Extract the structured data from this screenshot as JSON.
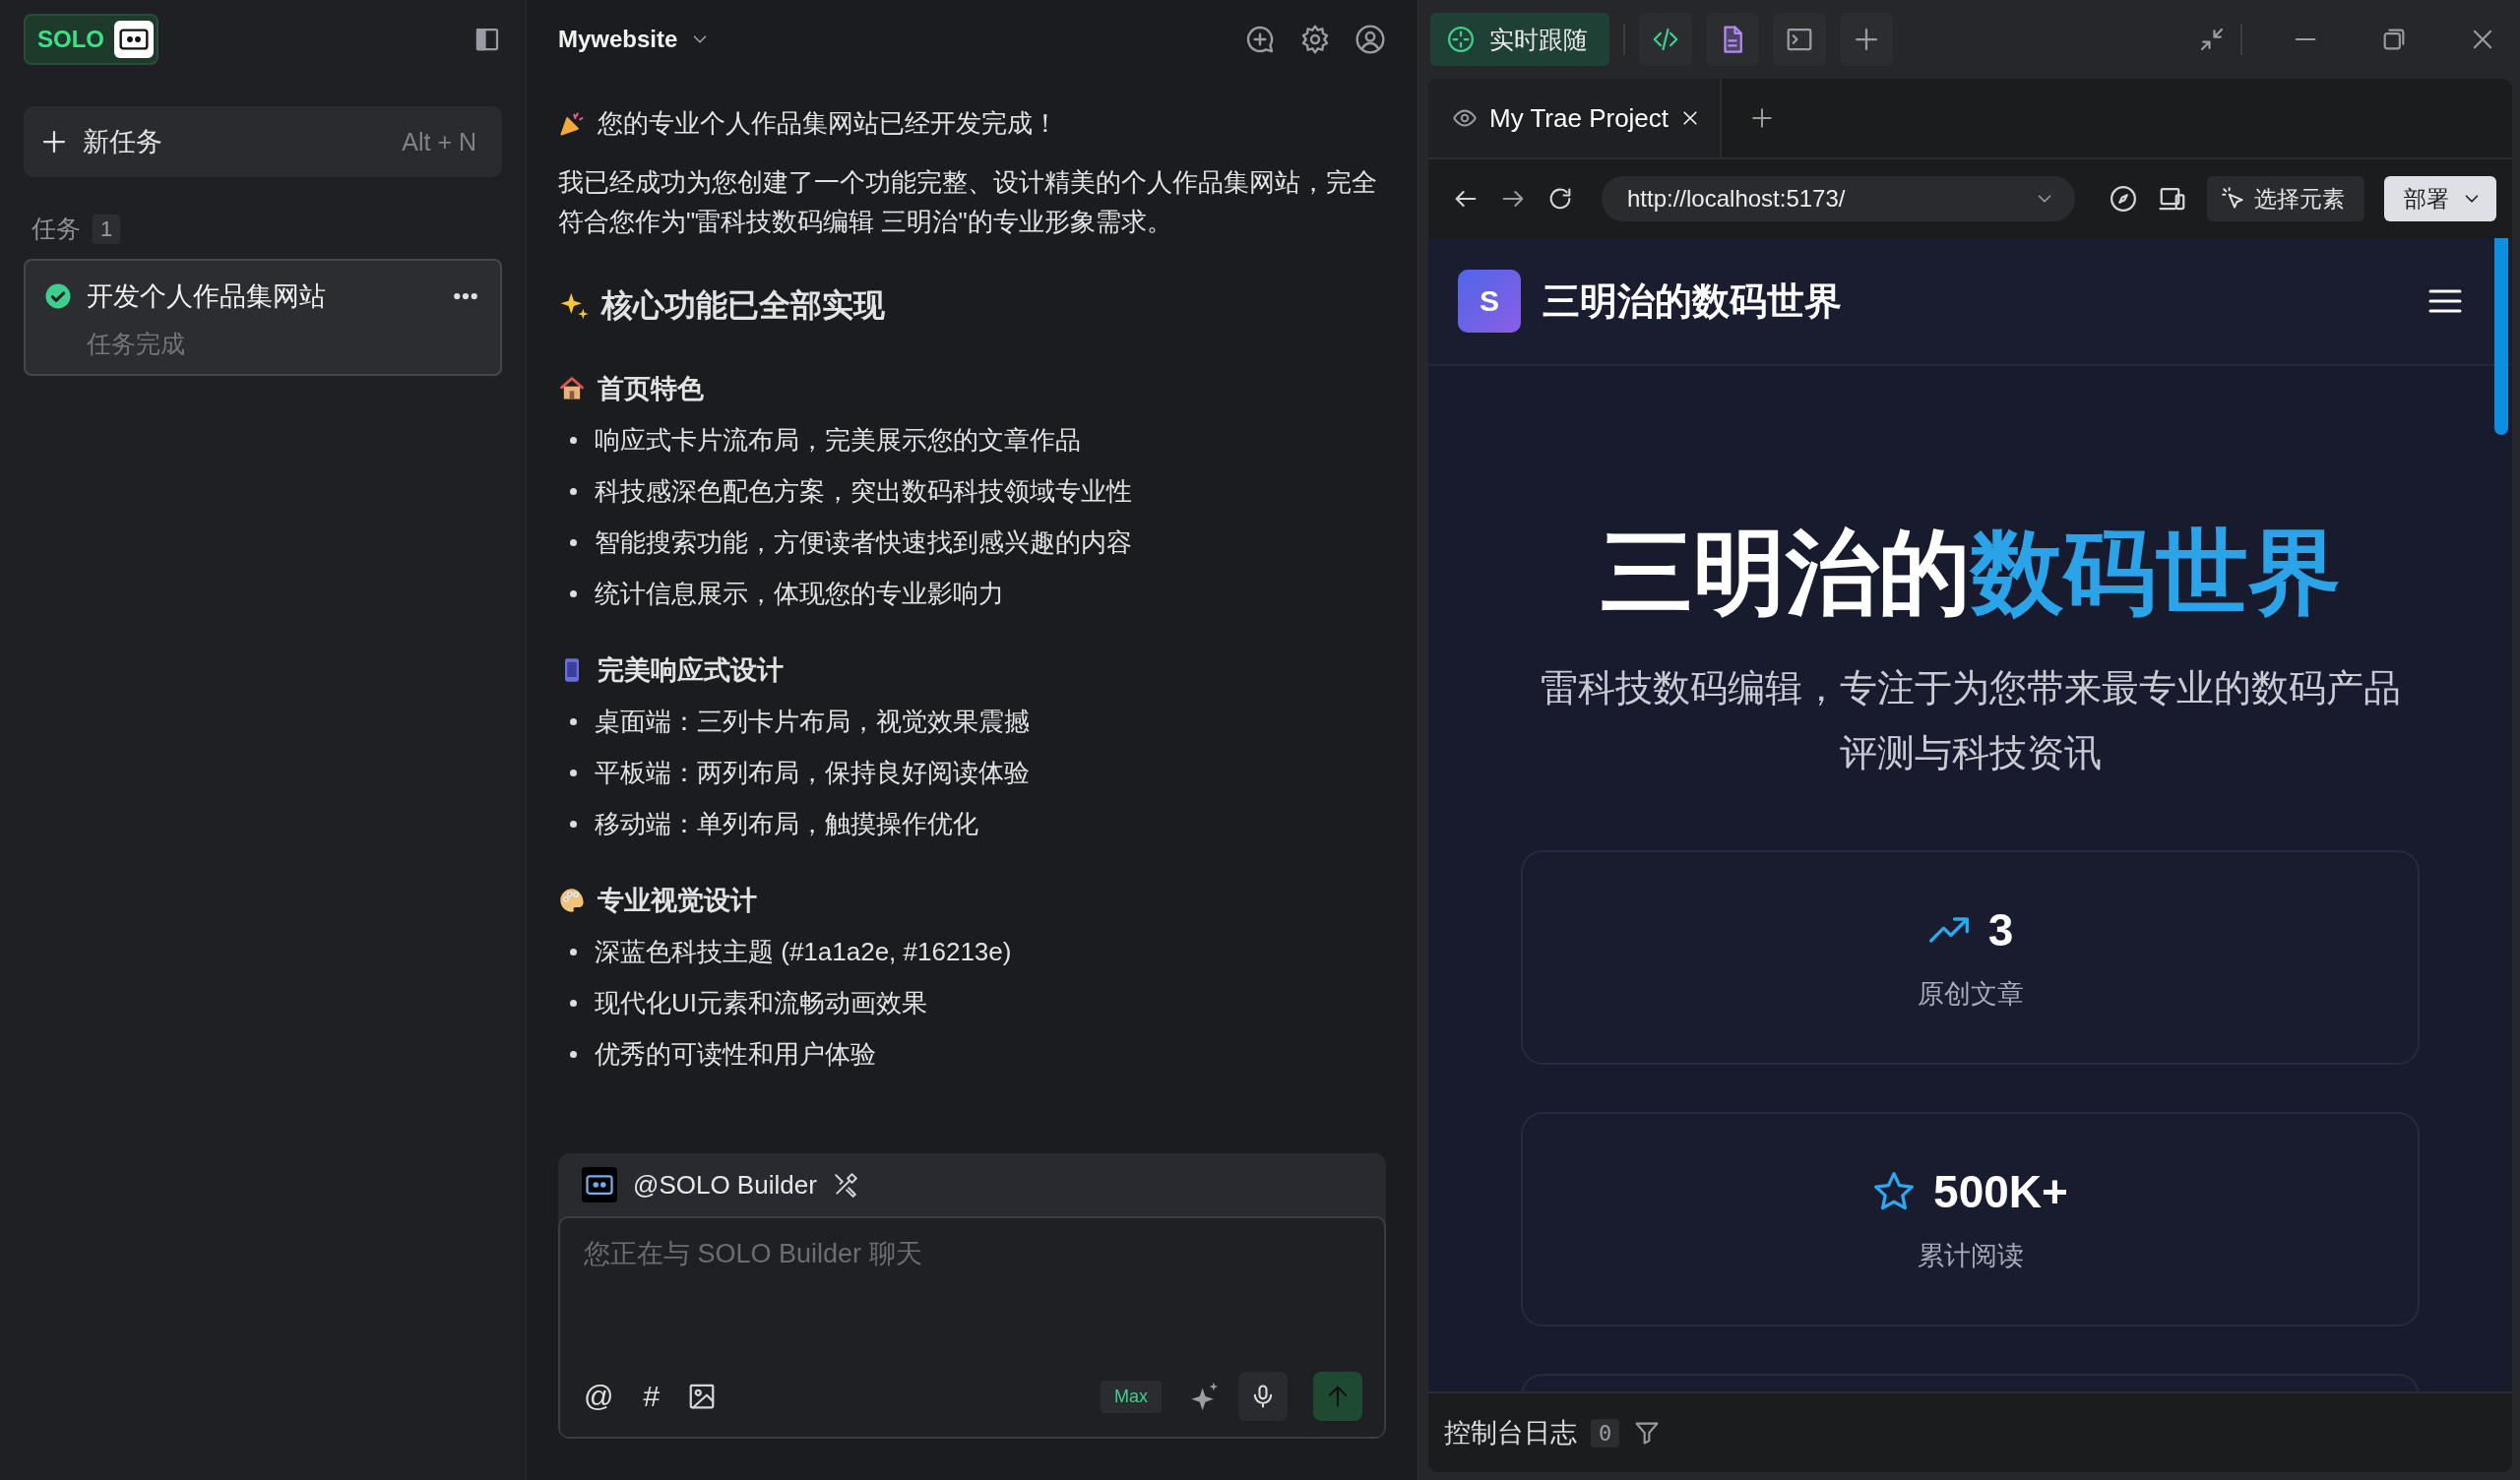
{
  "sidebar": {
    "logo": "SOLO",
    "new_task": {
      "label": "新任务",
      "shortcut": "Alt + N"
    },
    "tasks_label": "任务",
    "tasks_count": "1",
    "tasks": [
      {
        "title": "开发个人作品集网站",
        "status": "任务完成",
        "done": true
      }
    ]
  },
  "chat": {
    "project": "Mywebsite",
    "intro": "您的专业个人作品集网站已经开发完成！",
    "paragraph": "我已经成功为您创建了一个功能完整、设计精美的个人作品集网站，完全符合您作为\"雷科技数码编辑 三明治\"的专业形象需求。",
    "heading": "核心功能已全部实现",
    "sections": [
      {
        "title": "首页特色",
        "bullets": [
          "响应式卡片流布局，完美展示您的文章作品",
          "科技感深色配色方案，突出数码科技领域专业性",
          "智能搜索功能，方便读者快速找到感兴趣的内容",
          "统计信息展示，体现您的专业影响力"
        ]
      },
      {
        "title": "完美响应式设计",
        "bullets": [
          "桌面端：三列卡片布局，视觉效果震撼",
          "平板端：两列布局，保持良好阅读体验",
          "移动端：单列布局，触摸操作优化"
        ]
      },
      {
        "title": "专业视觉设计",
        "bullets": [
          "深蓝色科技主题 (#1a1a2e, #16213e)",
          "现代化UI元素和流畅动画效果",
          "优秀的可读性和用户体验"
        ]
      }
    ],
    "composer": {
      "agent": "@SOLO Builder",
      "placeholder": "您正在与 SOLO Builder 聊天",
      "tools": [
        "@",
        "#"
      ],
      "mode": "Max"
    }
  },
  "preview": {
    "follow": {
      "label": "实时跟随",
      "on": true
    },
    "tabs": [
      {
        "label": "My Trae Project",
        "selected": true
      }
    ],
    "url": "http://localhost:5173/",
    "select_element": "选择元素",
    "deploy": "部署",
    "site": {
      "logo_letter": "S",
      "brand": "三明治的数码世界",
      "title_plain": "三明治的",
      "title_accent": "数码世界",
      "subtitle": "雷科技数码编辑，专注于为您带来最专业的数码产品评测与科技资讯",
      "stats": [
        {
          "kind": "trend",
          "value": "3",
          "label": "原创文章"
        },
        {
          "kind": "star",
          "value": "500K+",
          "label": "累计阅读"
        }
      ]
    },
    "console": {
      "label": "控制台日志",
      "count": "0"
    }
  }
}
